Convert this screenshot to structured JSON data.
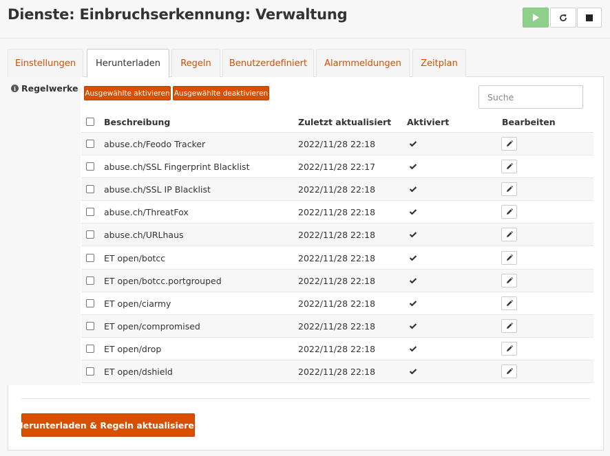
{
  "header": {
    "title": "Dienste: Einbruchserkennung: Verwaltung",
    "play_icon": "play-icon",
    "restart_icon": "restart-icon",
    "stop_icon": "stop-icon",
    "play_color": "#8fd08c"
  },
  "tabs": [
    {
      "label": "Einstellungen",
      "active": false
    },
    {
      "label": "Herunterladen",
      "active": true
    },
    {
      "label": "Regeln",
      "active": false
    },
    {
      "label": "Benutzerdefiniert",
      "active": false
    },
    {
      "label": "Alarmmeldungen",
      "active": false
    },
    {
      "label": "Zeitplan",
      "active": false
    }
  ],
  "section": {
    "label": "Regelwerke",
    "info_icon": "info-icon"
  },
  "bulk": {
    "activate_label": "Ausgewählte aktivieren",
    "deactivate_label": "Ausgewählte deaktivieren"
  },
  "search": {
    "placeholder": "Suche",
    "value": ""
  },
  "table": {
    "columns": [
      "Beschreibung",
      "Zuletzt aktualisiert",
      "Aktiviert",
      "Bearbeiten"
    ],
    "rows": [
      {
        "description": "abuse.ch/Feodo Tracker",
        "updated": "2022/11/28 22:18",
        "enabled": true
      },
      {
        "description": "abuse.ch/SSL Fingerprint Blacklist",
        "updated": "2022/11/28 22:17",
        "enabled": true
      },
      {
        "description": "abuse.ch/SSL IP Blacklist",
        "updated": "2022/11/28 22:18",
        "enabled": true
      },
      {
        "description": "abuse.ch/ThreatFox",
        "updated": "2022/11/28 22:18",
        "enabled": true
      },
      {
        "description": "abuse.ch/URLhaus",
        "updated": "2022/11/28 22:18",
        "enabled": true
      },
      {
        "description": "ET open/botcc",
        "updated": "2022/11/28 22:18",
        "enabled": true
      },
      {
        "description": "ET open/botcc.portgrouped",
        "updated": "2022/11/28 22:18",
        "enabled": true
      },
      {
        "description": "ET open/ciarmy",
        "updated": "2022/11/28 22:18",
        "enabled": true
      },
      {
        "description": "ET open/compromised",
        "updated": "2022/11/28 22:18",
        "enabled": true
      },
      {
        "description": "ET open/drop",
        "updated": "2022/11/28 22:18",
        "enabled": true
      },
      {
        "description": "ET open/dshield",
        "updated": "2022/11/28 22:18",
        "enabled": true
      }
    ],
    "check_icon": "check-icon",
    "edit_icon": "pencil-icon"
  },
  "footer": {
    "action_label": "Herunterladen & Regeln aktualisieren"
  },
  "colors": {
    "accent": "#d94f00",
    "tab_text": "#d94f00"
  }
}
